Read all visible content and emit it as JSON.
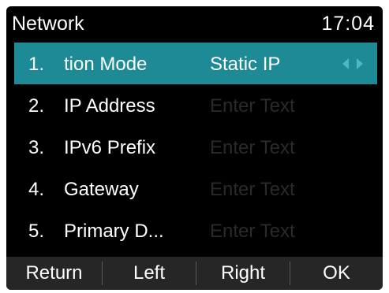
{
  "header": {
    "title": "Network",
    "time": "17:04"
  },
  "rows": [
    {
      "number": "1.",
      "label": "tion Mode",
      "value": "Static IP",
      "selected": true
    },
    {
      "number": "2.",
      "label": "IP Address",
      "value": "Enter Text"
    },
    {
      "number": "3.",
      "label": "IPv6 Prefix",
      "value": "Enter Text"
    },
    {
      "number": "4.",
      "label": "Gateway",
      "value": "Enter Text"
    },
    {
      "number": "5.",
      "label": "Primary D...",
      "value": "Enter Text"
    }
  ],
  "softkeys": {
    "return": "Return",
    "left": "Left",
    "right": "Right",
    "ok": "OK"
  },
  "icons": {
    "selector": "left-right-arrows-icon"
  },
  "colors": {
    "background": "#000000",
    "selection": "#1e8a96",
    "placeholder_text": "#2a2a2a",
    "softkey_bar": "#262626",
    "arrow": "#4fb6c2"
  }
}
